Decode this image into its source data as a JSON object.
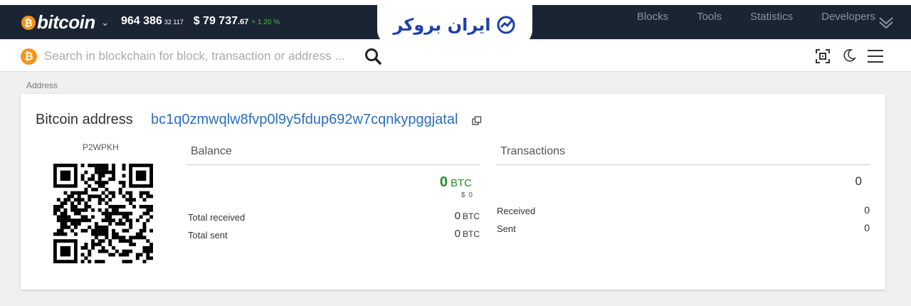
{
  "navbar": {
    "brand": "bitcoin",
    "blocks": "964 386",
    "blocks_sub": "32 117",
    "price": "$ 79 737",
    "price_dec": ".67",
    "change": "+ 1.20 %",
    "links": [
      "Blocks",
      "Tools",
      "Statistics",
      "Developers"
    ]
  },
  "logo": {
    "text": "ایران بروکر"
  },
  "search": {
    "placeholder": "Search in blockchain for block, transaction or address ..."
  },
  "breadcrumb": "Address",
  "card": {
    "title": "Bitcoin address",
    "address": "bc1q0zmwqlw8fvp0l9y5fdup692w7cqnkypggjatal",
    "type": "P2WPKH",
    "balance": {
      "title": "Balance",
      "amount": "0",
      "unit": "BTC",
      "usd": "$ 0",
      "total_received_label": "Total received",
      "total_received": "0",
      "total_sent_label": "Total sent",
      "total_sent": "0"
    },
    "transactions": {
      "title": "Transactions",
      "count": "0",
      "received_label": "Received",
      "received": "0",
      "sent_label": "Sent",
      "sent": "0"
    }
  }
}
